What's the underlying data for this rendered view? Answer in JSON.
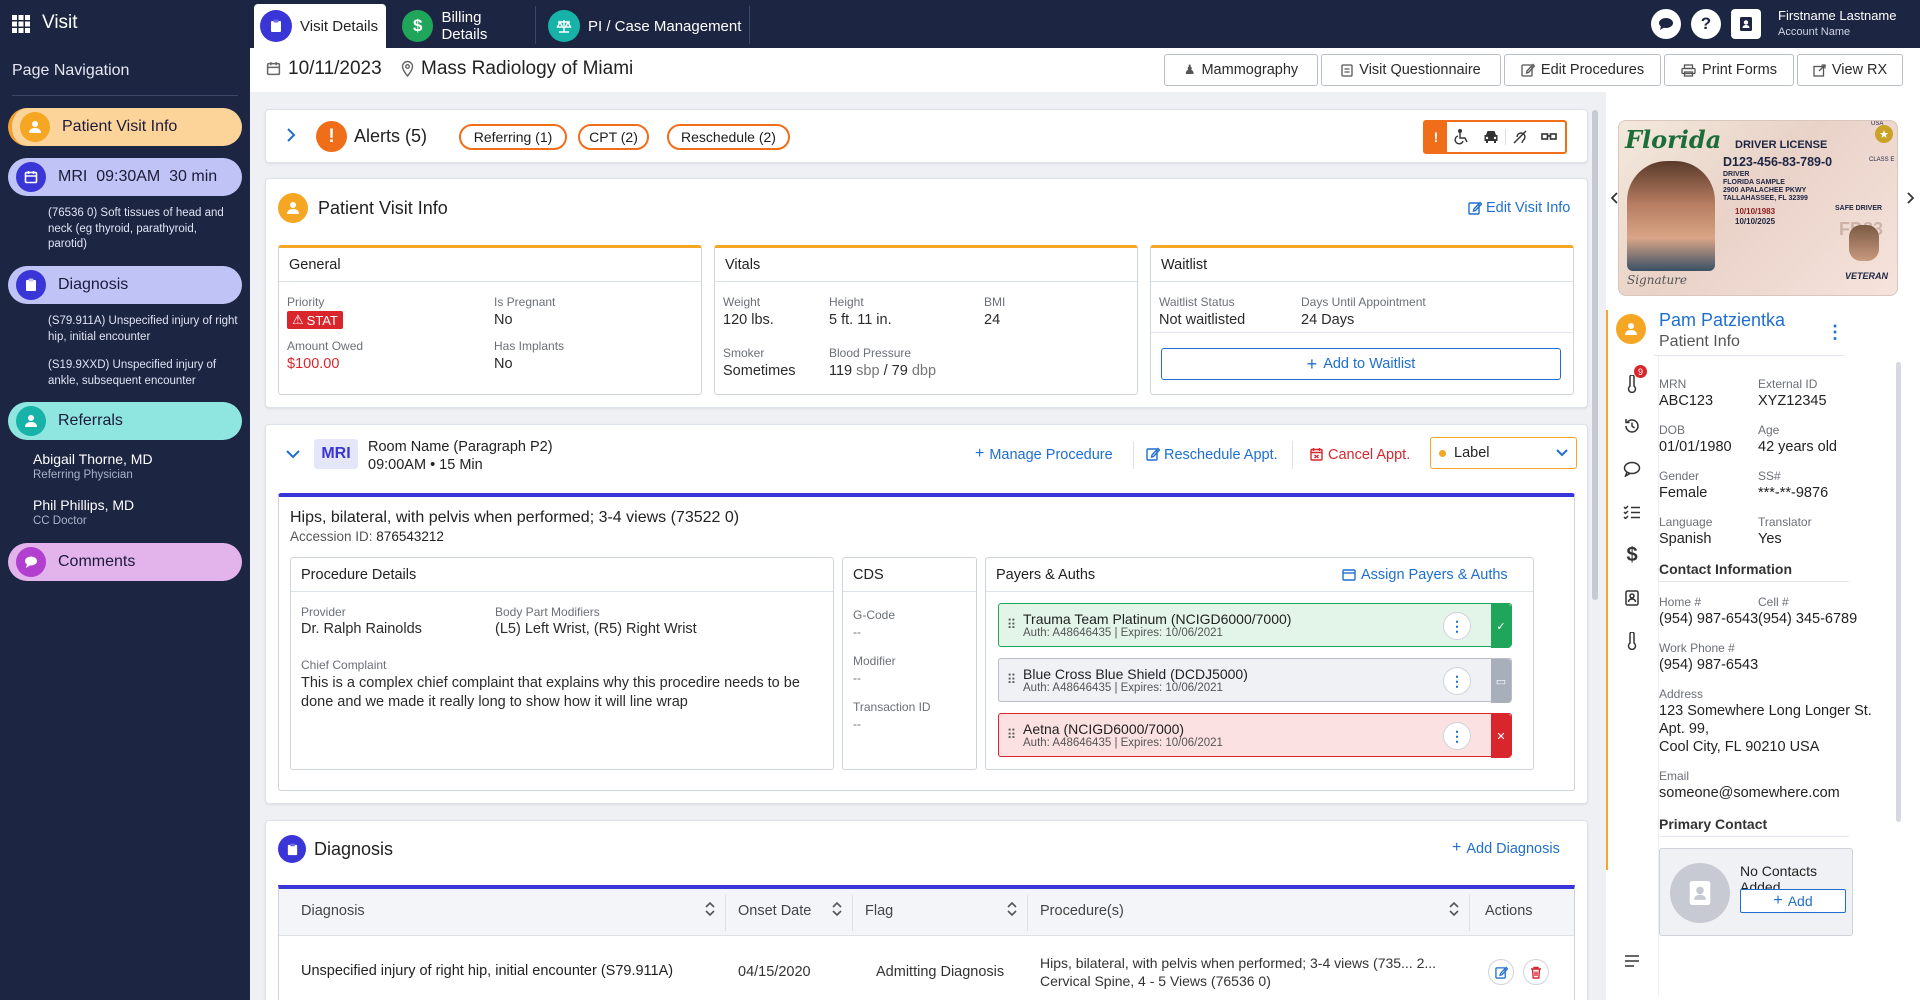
{
  "app": {
    "title": "Visit",
    "nav_title": "Page Navigation"
  },
  "sidebar": {
    "patient_visit": "Patient Visit Info",
    "mri": {
      "label": "MRI  09:30AM  30 min",
      "sub": "(76536 0) Soft tissues of head and neck (eg thyroid, parathyroid, parotid)"
    },
    "diagnosis": {
      "label": "Diagnosis",
      "sub1": "(S79.911A) Unspecified injury of right hip, initial encounter",
      "sub2": "(S19.9XXD) Unspecified injury of ankle, subsequent encounter"
    },
    "referrals": {
      "label": "Referrals",
      "p1_name": "Abigail Thorne, MD",
      "p1_role": "Referring Physician",
      "p2_name": "Phil Phillips, MD",
      "p2_role": "CC Doctor"
    },
    "comments": "Comments"
  },
  "tabs": [
    "Visit Details",
    "Billing Details",
    "PI / Case Management"
  ],
  "user": {
    "name": "Firstname Lastname",
    "account": "Account Name"
  },
  "visit": {
    "date": "10/11/2023",
    "location": "Mass Radiology of Miami"
  },
  "toolbar": [
    "Mammography",
    "Visit Questionnaire",
    "Edit Procedures",
    "Print Forms",
    "View RX"
  ],
  "alerts": {
    "title": "Alerts (5)",
    "pills": [
      "Referring (1)",
      "CPT (2)",
      "Reschedule (2)"
    ]
  },
  "pvi": {
    "title": "Patient Visit Info",
    "edit": "Edit Visit Info",
    "general": {
      "title": "General",
      "priority_lbl": "Priority",
      "priority": "STAT",
      "pregnant_lbl": "Is Pregnant",
      "pregnant": "No",
      "owed_lbl": "Amount Owed",
      "owed": "$100.00",
      "implants_lbl": "Has Implants",
      "implants": "No"
    },
    "vitals": {
      "title": "Vitals",
      "weight_lbl": "Weight",
      "weight": "120 lbs.",
      "height_lbl": "Height",
      "height": "5 ft. 11 in.",
      "bmi_lbl": "BMI",
      "bmi": "24",
      "smoker_lbl": "Smoker",
      "smoker": "Sometimes",
      "bp_lbl": "Blood Pressure",
      "bp_sys": "119",
      "bp_sys_u": "sbp",
      "bp_sep": "/",
      "bp_dia": "79",
      "bp_dia_u": "dbp"
    },
    "waitlist": {
      "title": "Waitlist",
      "status_lbl": "Waitlist Status",
      "status": "Not waitlisted",
      "days_lbl": "Days Until Appointment",
      "days": "24 Days",
      "add": "Add to Waitlist"
    }
  },
  "procedure": {
    "modality": "MRI",
    "room": "Room Name (Paragraph P2)",
    "time": "09:00AM • 15 Min",
    "manage": "Manage Procedure",
    "reschedule": "Reschedule Appt.",
    "cancel": "Cancel Appt.",
    "label": "Label",
    "name": "Hips, bilateral, with pelvis when performed; 3-4 views (73522 0)",
    "accession_lbl": "Accession ID:",
    "accession": "876543212",
    "details": {
      "title": "Procedure Details",
      "provider_lbl": "Provider",
      "provider": "Dr. Ralph Rainolds",
      "bpm_lbl": "Body Part Modifiers",
      "bpm": "(L5) Left Wrist, (R5) Right Wrist",
      "cc_lbl": "Chief Complaint",
      "cc": "This is a complex chief complaint that explains why this procedire needs to be done and we made it really long to show how it will line wrap"
    },
    "cds": {
      "title": "CDS",
      "gcode_lbl": "G-Code",
      "gcode": "--",
      "mod_lbl": "Modifier",
      "mod": "--",
      "tx_lbl": "Transaction ID",
      "tx": "--"
    },
    "payers": {
      "title": "Payers & Auths",
      "assign": "Assign Payers & Auths",
      "items": [
        {
          "name": "Trauma Team Platinum (NCIGD6000/7000)",
          "auth": "Auth: A48646435 | Expires: 10/06/2021"
        },
        {
          "name": "Blue Cross Blue Shield (DCDJ5000)",
          "auth": "Auth: A48646435 | Expires: 10/06/2021"
        },
        {
          "name": "Aetna (NCIGD6000/7000)",
          "auth": "Auth: A48646435 | Expires: 10/06/2021"
        }
      ]
    }
  },
  "diagnosis": {
    "title": "Diagnosis",
    "add": "Add Diagnosis",
    "columns": [
      "Diagnosis",
      "Onset Date",
      "Flag",
      "Procedure(s)",
      "Actions"
    ],
    "rows": [
      {
        "diagnosis": "Unspecified injury of right hip, initial encounter (S79.911A)",
        "onset": "04/15/2020",
        "flag": "Admitting Diagnosis",
        "proc1": "Hips, bilateral, with pelvis when performed; 3-4 views (735... 2...",
        "proc2": "Cervical Spine, 4 - 5 Views (76536 0)"
      }
    ]
  },
  "license": {
    "state": "Florida",
    "type": "DRIVER LICENSE",
    "number": "D123-456-83-789-0",
    "class_lbl": "CLASS",
    "class": "E",
    "name1": "DRIVER",
    "name2": "FLORIDA SAMPLE",
    "addr1": "2900 APALACHEE PKWY",
    "addr2": "TALLAHASSEE, FL 32399",
    "dob": "10/10/1983",
    "exp": "10/10/2025",
    "safe": "SAFE DRIVER",
    "veteran": "VETERAN",
    "fd": "FD83",
    "sig": "Signature",
    "usa": "USA"
  },
  "patient": {
    "name": "Pam Patzientka",
    "subtitle": "Patient Info",
    "badge": "9",
    "fields": [
      {
        "l": "MRN",
        "v": "ABC123"
      },
      {
        "l": "External ID",
        "v": "XYZ12345"
      },
      {
        "l": "DOB",
        "v": "01/01/1980"
      },
      {
        "l": "Age",
        "v": "42 years old"
      },
      {
        "l": "Gender",
        "v": "Female"
      },
      {
        "l": "SS#",
        "v": "***-**-9876"
      },
      {
        "l": "Language",
        "v": "Spanish"
      },
      {
        "l": "Translator",
        "v": "Yes"
      }
    ],
    "contact_title": "Contact Information",
    "home_lbl": "Home #",
    "home": "(954) 987-6543",
    "cell_lbl": "Cell #",
    "cell": "(954) 345-6789",
    "work_lbl": "Work Phone #",
    "work": "(954) 987-6543",
    "addr_lbl": "Address",
    "addr1": "123 Somewhere Long Longer St.",
    "addr2": "Apt. 99,",
    "addr3": "Cool City, FL 90210 USA",
    "email_lbl": "Email",
    "email": "someone@somewhere.com",
    "primary_title": "Primary Contact",
    "no_contacts": "No Contacts Added",
    "add": "Add"
  },
  "colors": {
    "navy": "#1c2542",
    "orange": "#f06e1a",
    "blue": "#1f6fd0",
    "indigo": "#3a35d6",
    "red": "#d9262c",
    "green": "#1fa65a"
  }
}
